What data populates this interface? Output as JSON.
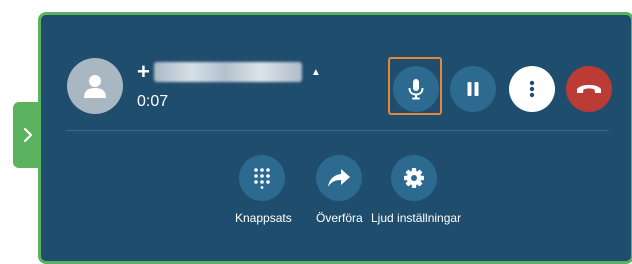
{
  "call": {
    "number_prefix": "+",
    "number_masked": "blurred-number",
    "timer": "0:07"
  },
  "controls": {
    "mute_icon": "microphone-icon",
    "hold_icon": "pause-icon",
    "more_icon": "vertical-dots-icon",
    "hangup_icon": "phone-hangup-icon"
  },
  "actions": [
    {
      "label": "Knappsats",
      "icon": "keypad-icon"
    },
    {
      "label": "Överföra",
      "icon": "forward-arrow-icon"
    },
    {
      "label": "Ljud inställningar",
      "icon": "gear-icon"
    }
  ],
  "colors": {
    "panel_bg": "#1f4d6e",
    "panel_border": "#5cb35f",
    "button_bg": "#2c6a8f",
    "hangup": "#bc3b34",
    "focus": "#e8873a",
    "avatar": "#a9b7c3"
  }
}
